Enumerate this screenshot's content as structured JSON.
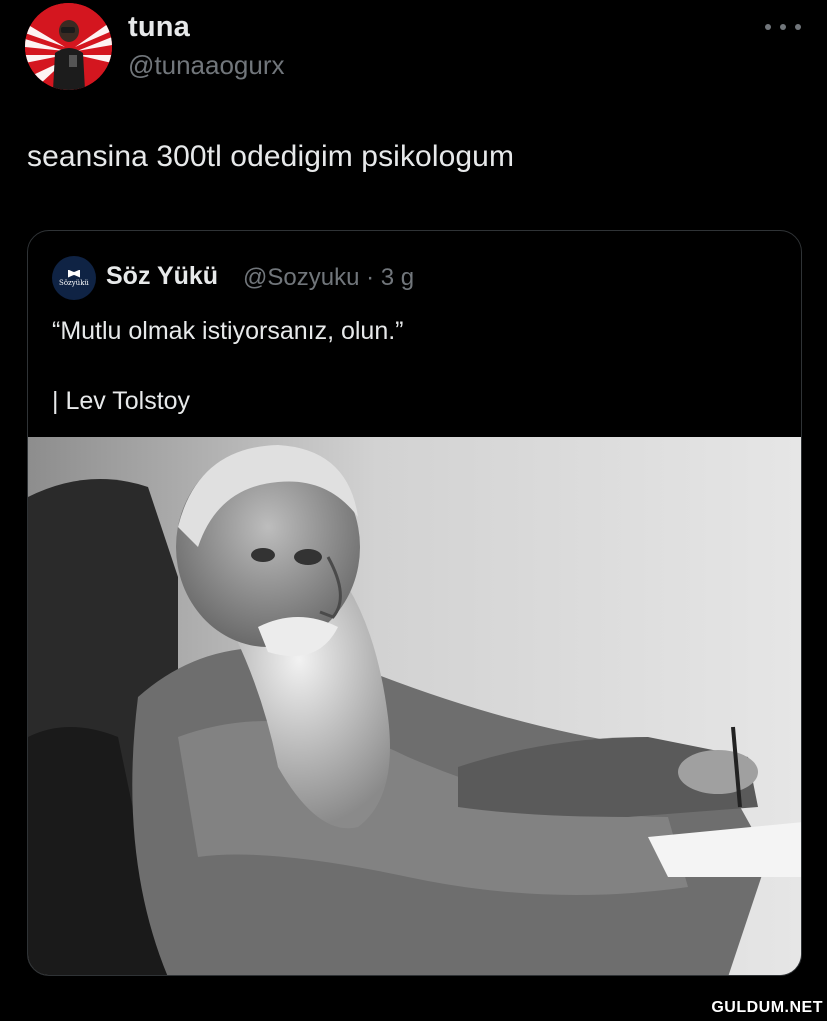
{
  "tweet": {
    "author": {
      "display_name": "tuna",
      "handle": "@tunaaogurx"
    },
    "text": "seansina 300tl odedigim psikologum",
    "more_icon": "more-horizontal-icon"
  },
  "quoted_tweet": {
    "author": {
      "display_name": "Söz Yükü",
      "handle_and_time": "@Sozyuku · 3 g",
      "avatar_text": "Sözyükü"
    },
    "line1": "“Mutlu olmak istiyorsanız, olun.”",
    "line2": "| Lev Tolstoy",
    "image_description_icon": "photo"
  },
  "watermark": "GULDUM.NET",
  "colors": {
    "background": "#000000",
    "text_primary": "#e7e9ea",
    "text_secondary": "#71767b",
    "card_border": "#2f3336",
    "avatar_red": "#d4161f",
    "quote_avatar_navy": "#0f2344"
  }
}
